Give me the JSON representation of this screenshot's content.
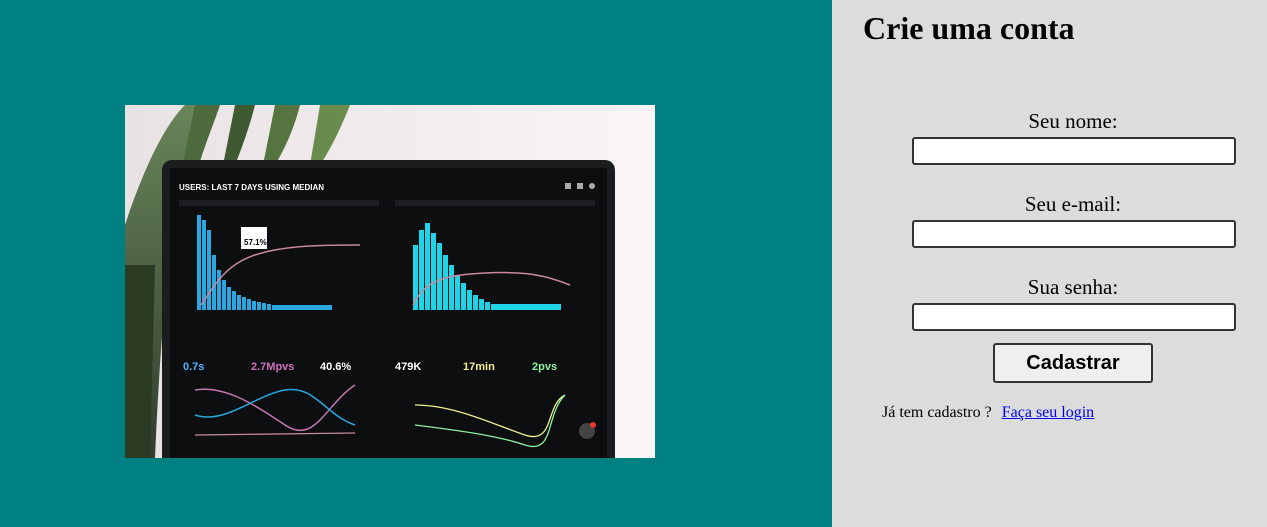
{
  "signup": {
    "title": "Crie uma conta",
    "fields": [
      {
        "label": "Seu nome:",
        "value": "",
        "type": "text"
      },
      {
        "label": "Seu e-mail:",
        "value": "",
        "type": "email"
      },
      {
        "label": "Sua senha:",
        "value": "",
        "type": "password"
      }
    ],
    "submit_label": "Cadastrar",
    "login_prompt": "Já tem cadastro ?",
    "login_link": "Faça seu login"
  },
  "photo": {
    "header_text": "USERS: LAST 7 DAYS USING MEDIAN",
    "callout": "57.1%",
    "metrics": [
      {
        "value": "0.7s",
        "color": "#4fb3ff"
      },
      {
        "value": "2.7Mpvs",
        "color": "#d070c0"
      },
      {
        "value": "40.6%",
        "color": "#ffffff"
      },
      {
        "value": "479K",
        "color": "#ffffff"
      },
      {
        "value": "17min",
        "color": "#f0f090"
      },
      {
        "value": "2pvs",
        "color": "#90f0a0"
      }
    ]
  },
  "colors": {
    "left_bg": "#008080",
    "right_bg": "#dcdcdc",
    "link": "#0000ee"
  }
}
